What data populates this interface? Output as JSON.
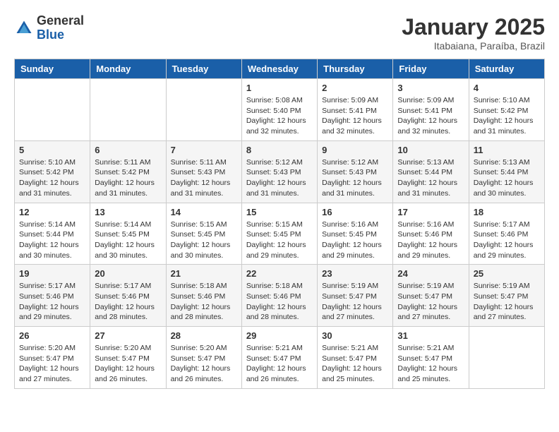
{
  "logo": {
    "general": "General",
    "blue": "Blue"
  },
  "title": {
    "month": "January 2025",
    "location": "Itabaiana, Paraíba, Brazil"
  },
  "weekdays": [
    "Sunday",
    "Monday",
    "Tuesday",
    "Wednesday",
    "Thursday",
    "Friday",
    "Saturday"
  ],
  "weeks": [
    [
      {
        "day": "",
        "info": ""
      },
      {
        "day": "",
        "info": ""
      },
      {
        "day": "",
        "info": ""
      },
      {
        "day": "1",
        "info": "Sunrise: 5:08 AM\nSunset: 5:40 PM\nDaylight: 12 hours\nand 32 minutes."
      },
      {
        "day": "2",
        "info": "Sunrise: 5:09 AM\nSunset: 5:41 PM\nDaylight: 12 hours\nand 32 minutes."
      },
      {
        "day": "3",
        "info": "Sunrise: 5:09 AM\nSunset: 5:41 PM\nDaylight: 12 hours\nand 32 minutes."
      },
      {
        "day": "4",
        "info": "Sunrise: 5:10 AM\nSunset: 5:42 PM\nDaylight: 12 hours\nand 31 minutes."
      }
    ],
    [
      {
        "day": "5",
        "info": "Sunrise: 5:10 AM\nSunset: 5:42 PM\nDaylight: 12 hours\nand 31 minutes."
      },
      {
        "day": "6",
        "info": "Sunrise: 5:11 AM\nSunset: 5:42 PM\nDaylight: 12 hours\nand 31 minutes."
      },
      {
        "day": "7",
        "info": "Sunrise: 5:11 AM\nSunset: 5:43 PM\nDaylight: 12 hours\nand 31 minutes."
      },
      {
        "day": "8",
        "info": "Sunrise: 5:12 AM\nSunset: 5:43 PM\nDaylight: 12 hours\nand 31 minutes."
      },
      {
        "day": "9",
        "info": "Sunrise: 5:12 AM\nSunset: 5:43 PM\nDaylight: 12 hours\nand 31 minutes."
      },
      {
        "day": "10",
        "info": "Sunrise: 5:13 AM\nSunset: 5:44 PM\nDaylight: 12 hours\nand 31 minutes."
      },
      {
        "day": "11",
        "info": "Sunrise: 5:13 AM\nSunset: 5:44 PM\nDaylight: 12 hours\nand 30 minutes."
      }
    ],
    [
      {
        "day": "12",
        "info": "Sunrise: 5:14 AM\nSunset: 5:44 PM\nDaylight: 12 hours\nand 30 minutes."
      },
      {
        "day": "13",
        "info": "Sunrise: 5:14 AM\nSunset: 5:45 PM\nDaylight: 12 hours\nand 30 minutes."
      },
      {
        "day": "14",
        "info": "Sunrise: 5:15 AM\nSunset: 5:45 PM\nDaylight: 12 hours\nand 30 minutes."
      },
      {
        "day": "15",
        "info": "Sunrise: 5:15 AM\nSunset: 5:45 PM\nDaylight: 12 hours\nand 29 minutes."
      },
      {
        "day": "16",
        "info": "Sunrise: 5:16 AM\nSunset: 5:45 PM\nDaylight: 12 hours\nand 29 minutes."
      },
      {
        "day": "17",
        "info": "Sunrise: 5:16 AM\nSunset: 5:46 PM\nDaylight: 12 hours\nand 29 minutes."
      },
      {
        "day": "18",
        "info": "Sunrise: 5:17 AM\nSunset: 5:46 PM\nDaylight: 12 hours\nand 29 minutes."
      }
    ],
    [
      {
        "day": "19",
        "info": "Sunrise: 5:17 AM\nSunset: 5:46 PM\nDaylight: 12 hours\nand 29 minutes."
      },
      {
        "day": "20",
        "info": "Sunrise: 5:17 AM\nSunset: 5:46 PM\nDaylight: 12 hours\nand 28 minutes."
      },
      {
        "day": "21",
        "info": "Sunrise: 5:18 AM\nSunset: 5:46 PM\nDaylight: 12 hours\nand 28 minutes."
      },
      {
        "day": "22",
        "info": "Sunrise: 5:18 AM\nSunset: 5:46 PM\nDaylight: 12 hours\nand 28 minutes."
      },
      {
        "day": "23",
        "info": "Sunrise: 5:19 AM\nSunset: 5:47 PM\nDaylight: 12 hours\nand 27 minutes."
      },
      {
        "day": "24",
        "info": "Sunrise: 5:19 AM\nSunset: 5:47 PM\nDaylight: 12 hours\nand 27 minutes."
      },
      {
        "day": "25",
        "info": "Sunrise: 5:19 AM\nSunset: 5:47 PM\nDaylight: 12 hours\nand 27 minutes."
      }
    ],
    [
      {
        "day": "26",
        "info": "Sunrise: 5:20 AM\nSunset: 5:47 PM\nDaylight: 12 hours\nand 27 minutes."
      },
      {
        "day": "27",
        "info": "Sunrise: 5:20 AM\nSunset: 5:47 PM\nDaylight: 12 hours\nand 26 minutes."
      },
      {
        "day": "28",
        "info": "Sunrise: 5:20 AM\nSunset: 5:47 PM\nDaylight: 12 hours\nand 26 minutes."
      },
      {
        "day": "29",
        "info": "Sunrise: 5:21 AM\nSunset: 5:47 PM\nDaylight: 12 hours\nand 26 minutes."
      },
      {
        "day": "30",
        "info": "Sunrise: 5:21 AM\nSunset: 5:47 PM\nDaylight: 12 hours\nand 25 minutes."
      },
      {
        "day": "31",
        "info": "Sunrise: 5:21 AM\nSunset: 5:47 PM\nDaylight: 12 hours\nand 25 minutes."
      },
      {
        "day": "",
        "info": ""
      }
    ]
  ]
}
